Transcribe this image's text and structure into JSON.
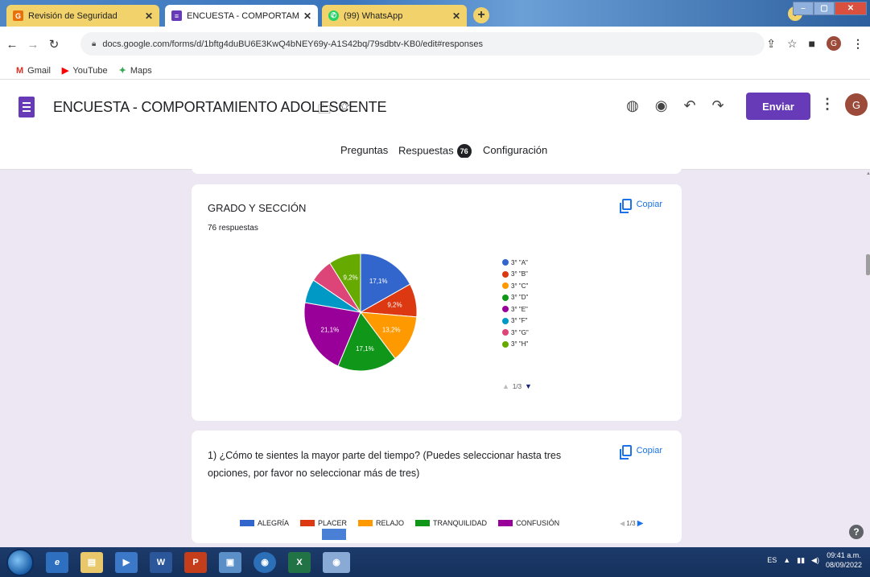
{
  "browser": {
    "tabs": [
      {
        "label": "Revisión de Seguridad",
        "favicon": "G",
        "favicon_color": "#e8710a",
        "active": false
      },
      {
        "label": "ENCUESTA - COMPORTAMIENTO",
        "favicon": "≡",
        "favicon_color": "#673ab7",
        "active": true
      },
      {
        "label": "(99) WhatsApp",
        "favicon": "✆",
        "favicon_color": "#25d366",
        "active": false
      }
    ],
    "url": "docs.google.com/forms/d/1bftg4duBU6E3KwQ4bNEY69y-A1S42bq/79sdbtv-KB0/edit#responses",
    "bookmarks": [
      {
        "label": "Gmail",
        "icon": "gmail-icon",
        "color": "#d93025"
      },
      {
        "label": "YouTube",
        "icon": "youtube-icon",
        "color": "#ff0000"
      },
      {
        "label": "Maps",
        "icon": "maps-icon",
        "color": "#34a853"
      }
    ],
    "profile_initial": "G"
  },
  "form": {
    "title": "ENCUESTA - COMPORTAMIENTO ADOLESCENTE",
    "send_label": "Enviar",
    "avatar_initial": "G",
    "tabs": {
      "questions": "Preguntas",
      "responses": "Respuestas",
      "responses_count": "76",
      "settings": "Configuración"
    },
    "accent_color": "#673ab7"
  },
  "card_grade": {
    "title": "GRADO Y SECCIÓN",
    "subtitle": "76 respuestas",
    "copy_label": "Copiar",
    "pager": "1/3"
  },
  "chart_data": {
    "type": "pie",
    "title": "GRADO Y SECCIÓN",
    "slices": [
      {
        "label": "3° \"A\"",
        "value": 17.1,
        "color": "#3366cc",
        "shown_label": "17,1%"
      },
      {
        "label": "3° \"B\"",
        "value": 9.2,
        "color": "#dc3912",
        "shown_label": "9,2%"
      },
      {
        "label": "3° \"C\"",
        "value": 13.2,
        "color": "#ff9900",
        "shown_label": "13,2%"
      },
      {
        "label": "3° \"D\"",
        "value": 17.1,
        "color": "#109618",
        "shown_label": "17,1%"
      },
      {
        "label": "3° \"E\"",
        "value": 21.1,
        "color": "#990099",
        "shown_label": "21,1%"
      },
      {
        "label": "3° \"F\"",
        "value": 6.6,
        "color": "#0099c6",
        "shown_label": ""
      },
      {
        "label": "3° \"G\"",
        "value": 6.6,
        "color": "#dd4477",
        "shown_label": ""
      },
      {
        "label": "3° \"H\"",
        "value": 9.2,
        "color": "#66aa00",
        "shown_label": "9,2%"
      }
    ],
    "legend_placement": "right"
  },
  "card_q1": {
    "question": "1) ¿Cómo te sientes la mayor parte del tiempo?  (Puedes seleccionar hasta tres opciones, por favor no seleccionar más de tres)",
    "copy_label": "Copiar",
    "legend": [
      {
        "label": "ALEGRÍA",
        "color": "#3366cc"
      },
      {
        "label": "PLACER",
        "color": "#dc3912"
      },
      {
        "label": "RELAJO",
        "color": "#ff9900"
      },
      {
        "label": "TRANQUILIDAD",
        "color": "#109618"
      },
      {
        "label": "CONFUSIÓN",
        "color": "#990099"
      }
    ],
    "pager": "1/3"
  },
  "taskbar": {
    "language": "ES",
    "time": "09:41 a.m.",
    "date": "08/09/2022"
  }
}
